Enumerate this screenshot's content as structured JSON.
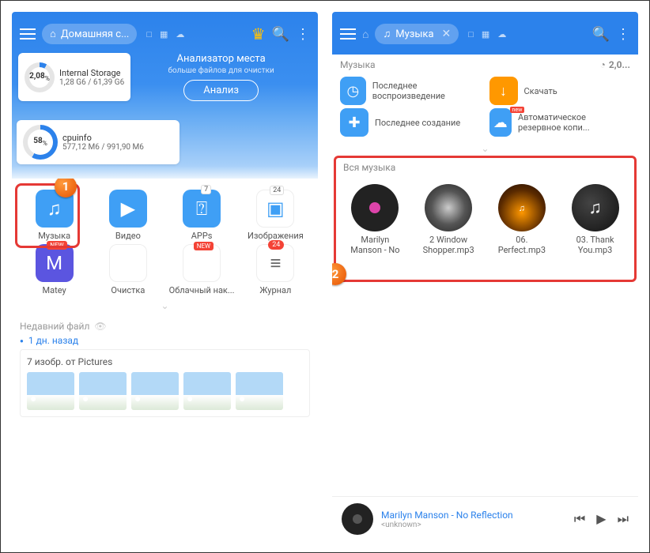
{
  "left": {
    "header": {
      "tab_label": "Домашняя с...",
      "analyzer_title": "Анализатор места",
      "analyzer_sub": "больше файлов для очистки",
      "analyze_btn": "Анализ"
    },
    "storage": {
      "percent": "2,08",
      "unit": "%",
      "name": "Internal Storage",
      "size": "1,28 G6 / 61,39 G6"
    },
    "cpu": {
      "percent": "58",
      "unit": "%",
      "name": "cpuinfo",
      "size": "577,12 M6 / 991,90 M6"
    },
    "grid": [
      {
        "label": "Музыка",
        "icon": "♫",
        "klass": "blue",
        "badge": null,
        "new": false
      },
      {
        "label": "Видео",
        "icon": "▶",
        "klass": "blue",
        "badge": null,
        "new": false
      },
      {
        "label": "APPs",
        "icon": "⍰",
        "klass": "blue",
        "badge": "7",
        "new": false
      },
      {
        "label": "Изображения",
        "icon": "▣",
        "klass": "outline",
        "badge": "24",
        "new": false
      },
      {
        "label": "Matey",
        "icon": "M",
        "klass": "purple",
        "badge": null,
        "new": true
      },
      {
        "label": "Очистка",
        "icon": "✦",
        "klass": "clean",
        "badge": null,
        "new": false
      },
      {
        "label": "Облачный нак...",
        "icon": "☁",
        "klass": "cloud",
        "badge": null,
        "new": true
      },
      {
        "label": "Журнал",
        "icon": "≡",
        "klass": "stack",
        "badge": "24",
        "badgeRed": true,
        "new": false
      }
    ],
    "recent": {
      "section": "Недавний файл",
      "date": "1 дн. назад",
      "card": "7 изобр. от Pictures"
    },
    "callout": "1"
  },
  "right": {
    "tab_label": "Музыка",
    "category": "Музыка",
    "size_badge": "2,0...",
    "quick": [
      {
        "label": "Последнее воспроизведение",
        "icon": "◷",
        "klass": "blue"
      },
      {
        "label": "Скачать",
        "icon": "↓",
        "klass": "orange"
      },
      {
        "label": "Последнее создание",
        "icon": "✚",
        "klass": "blue"
      },
      {
        "label": "Автоматическое резервное копи...",
        "icon": "☁",
        "klass": "blue",
        "new": true
      }
    ],
    "all_music": "Вся музыка",
    "tracks": [
      {
        "t1": "Marilyn",
        "t2": "Manson - No",
        "klass": "vinyl"
      },
      {
        "t1": "2 Window",
        "t2": "Shopper.mp3",
        "klass": "stone"
      },
      {
        "t1": "06.",
        "t2": "Perfect.mp3",
        "klass": "fire",
        "iconText": "♫"
      },
      {
        "t1": "03. Thank",
        "t2": "You.mp3",
        "klass": "dark",
        "iconText": "♫"
      }
    ],
    "player": {
      "title": "Marilyn Manson - No Reflection",
      "artist": "<unknown>"
    },
    "callout": "2"
  }
}
